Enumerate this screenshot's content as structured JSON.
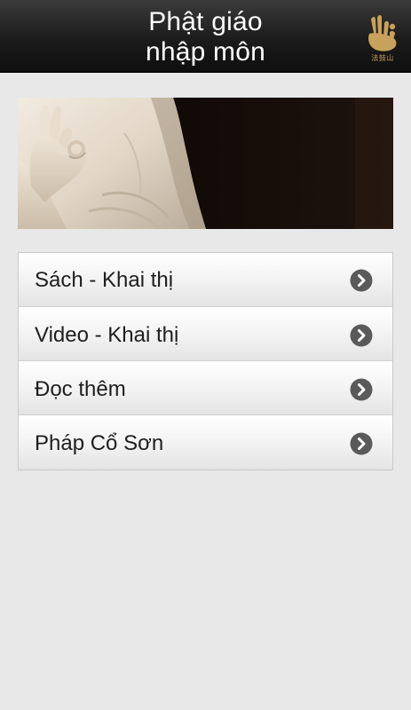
{
  "header": {
    "title_line1": "Phật giáo",
    "title_line2": "nhập môn",
    "logo_caption": "法鼓山",
    "logo_icon": "dharma-drum-logo-icon"
  },
  "banner": {
    "image": "buddha-statue-hand-mudra-image"
  },
  "menu": {
    "items": [
      {
        "label": "Sách - Khai thị",
        "icon": "chevron-right-circle-icon"
      },
      {
        "label": "Video - Khai thị",
        "icon": "chevron-right-circle-icon"
      },
      {
        "label": "Đọc thêm",
        "icon": "chevron-right-circle-icon"
      },
      {
        "label": "Pháp Cổ Sơn",
        "icon": "chevron-right-circle-icon"
      }
    ]
  },
  "colors": {
    "header_bg": "#1c1c1c",
    "header_text": "#ffffff",
    "logo_gold": "#c8a25a",
    "page_bg": "#e8e8e8",
    "chevron_bg": "#5a5a5a"
  }
}
